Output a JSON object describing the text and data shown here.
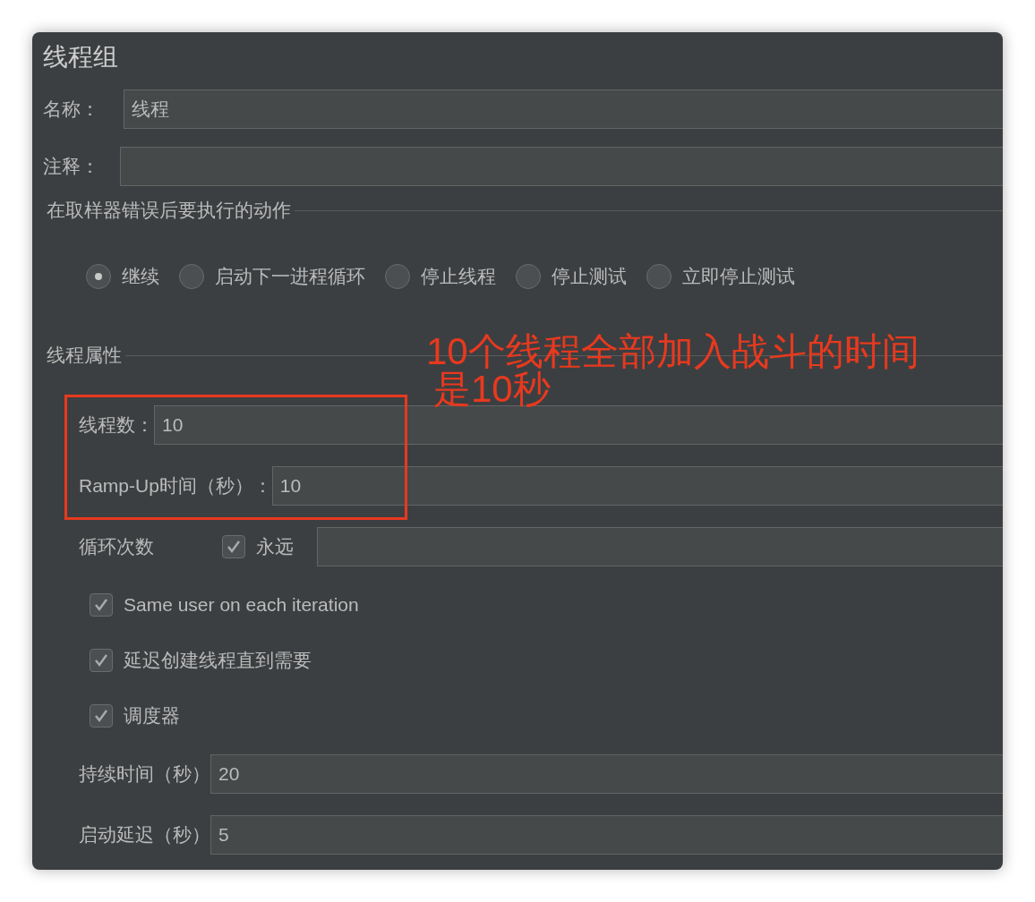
{
  "panel": {
    "title": "线程组"
  },
  "name_field": {
    "label": "名称：",
    "value": "线程"
  },
  "comment_field": {
    "label": "注释："
  },
  "error_action": {
    "title": "在取样器错误后要执行的动作",
    "options": [
      {
        "label": "继续",
        "selected": true
      },
      {
        "label": "启动下一进程循环",
        "selected": false
      },
      {
        "label": "停止线程",
        "selected": false
      },
      {
        "label": "停止测试",
        "selected": false
      },
      {
        "label": "立即停止测试",
        "selected": false
      }
    ]
  },
  "thread_props": {
    "title": "线程属性",
    "threads": {
      "label": "线程数：",
      "value": "10"
    },
    "rampup": {
      "label": "Ramp-Up时间（秒）：",
      "value": "10"
    },
    "loop": {
      "label": "循环次数",
      "forever_label": "永远",
      "forever_checked": true
    },
    "checkboxes": [
      {
        "label": "Same user on each iteration",
        "checked": true
      },
      {
        "label": "延迟创建线程直到需要",
        "checked": true
      },
      {
        "label": "调度器",
        "checked": true
      }
    ],
    "duration": {
      "label": "持续时间（秒）",
      "value": "20"
    },
    "delay": {
      "label": "启动延迟（秒）",
      "value": "5"
    }
  },
  "annotation": {
    "lines": [
      "10个线程全部加入战斗的时间",
      "是10秒"
    ]
  }
}
